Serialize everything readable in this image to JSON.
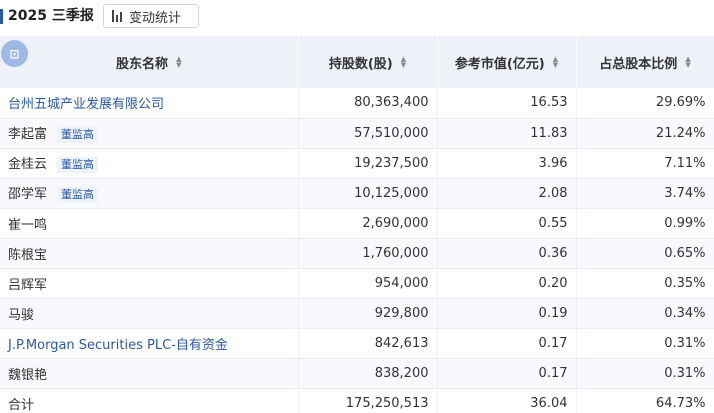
{
  "header": {
    "title": "2025 三季报",
    "change_button_label": "变动统计"
  },
  "float_button": {
    "glyph": "⊡"
  },
  "table": {
    "columns": [
      "股东名称",
      "持股数(股)",
      "参考市值(亿元)",
      "占总股本比例"
    ],
    "rows": [
      {
        "name": "台州五城产业发展有限公司",
        "is_link": true,
        "badge": "",
        "shares": "80,363,400",
        "market_value": "16.53",
        "ratio": "29.69%"
      },
      {
        "name": "李起富",
        "is_link": false,
        "badge": "董监高",
        "shares": "57,510,000",
        "market_value": "11.83",
        "ratio": "21.24%"
      },
      {
        "name": "金桂云",
        "is_link": false,
        "badge": "董监高",
        "shares": "19,237,500",
        "market_value": "3.96",
        "ratio": "7.11%"
      },
      {
        "name": "邵学军",
        "is_link": false,
        "badge": "董监高",
        "shares": "10,125,000",
        "market_value": "2.08",
        "ratio": "3.74%"
      },
      {
        "name": "崔一鸣",
        "is_link": false,
        "badge": "",
        "shares": "2,690,000",
        "market_value": "0.55",
        "ratio": "0.99%"
      },
      {
        "name": "陈根宝",
        "is_link": false,
        "badge": "",
        "shares": "1,760,000",
        "market_value": "0.36",
        "ratio": "0.65%"
      },
      {
        "name": "吕辉军",
        "is_link": false,
        "badge": "",
        "shares": "954,000",
        "market_value": "0.20",
        "ratio": "0.35%"
      },
      {
        "name": "马骏",
        "is_link": false,
        "badge": "",
        "shares": "929,800",
        "market_value": "0.19",
        "ratio": "0.34%"
      },
      {
        "name": "J.P.Morgan Securities PLC-自有资金",
        "is_link": true,
        "badge": "",
        "shares": "842,613",
        "market_value": "0.17",
        "ratio": "0.31%"
      },
      {
        "name": "魏银艳",
        "is_link": false,
        "badge": "",
        "shares": "838,200",
        "market_value": "0.17",
        "ratio": "0.31%"
      },
      {
        "name": "合计",
        "is_link": false,
        "badge": "",
        "shares": "175,250,513",
        "market_value": "36.04",
        "ratio": "64.73%"
      }
    ]
  }
}
